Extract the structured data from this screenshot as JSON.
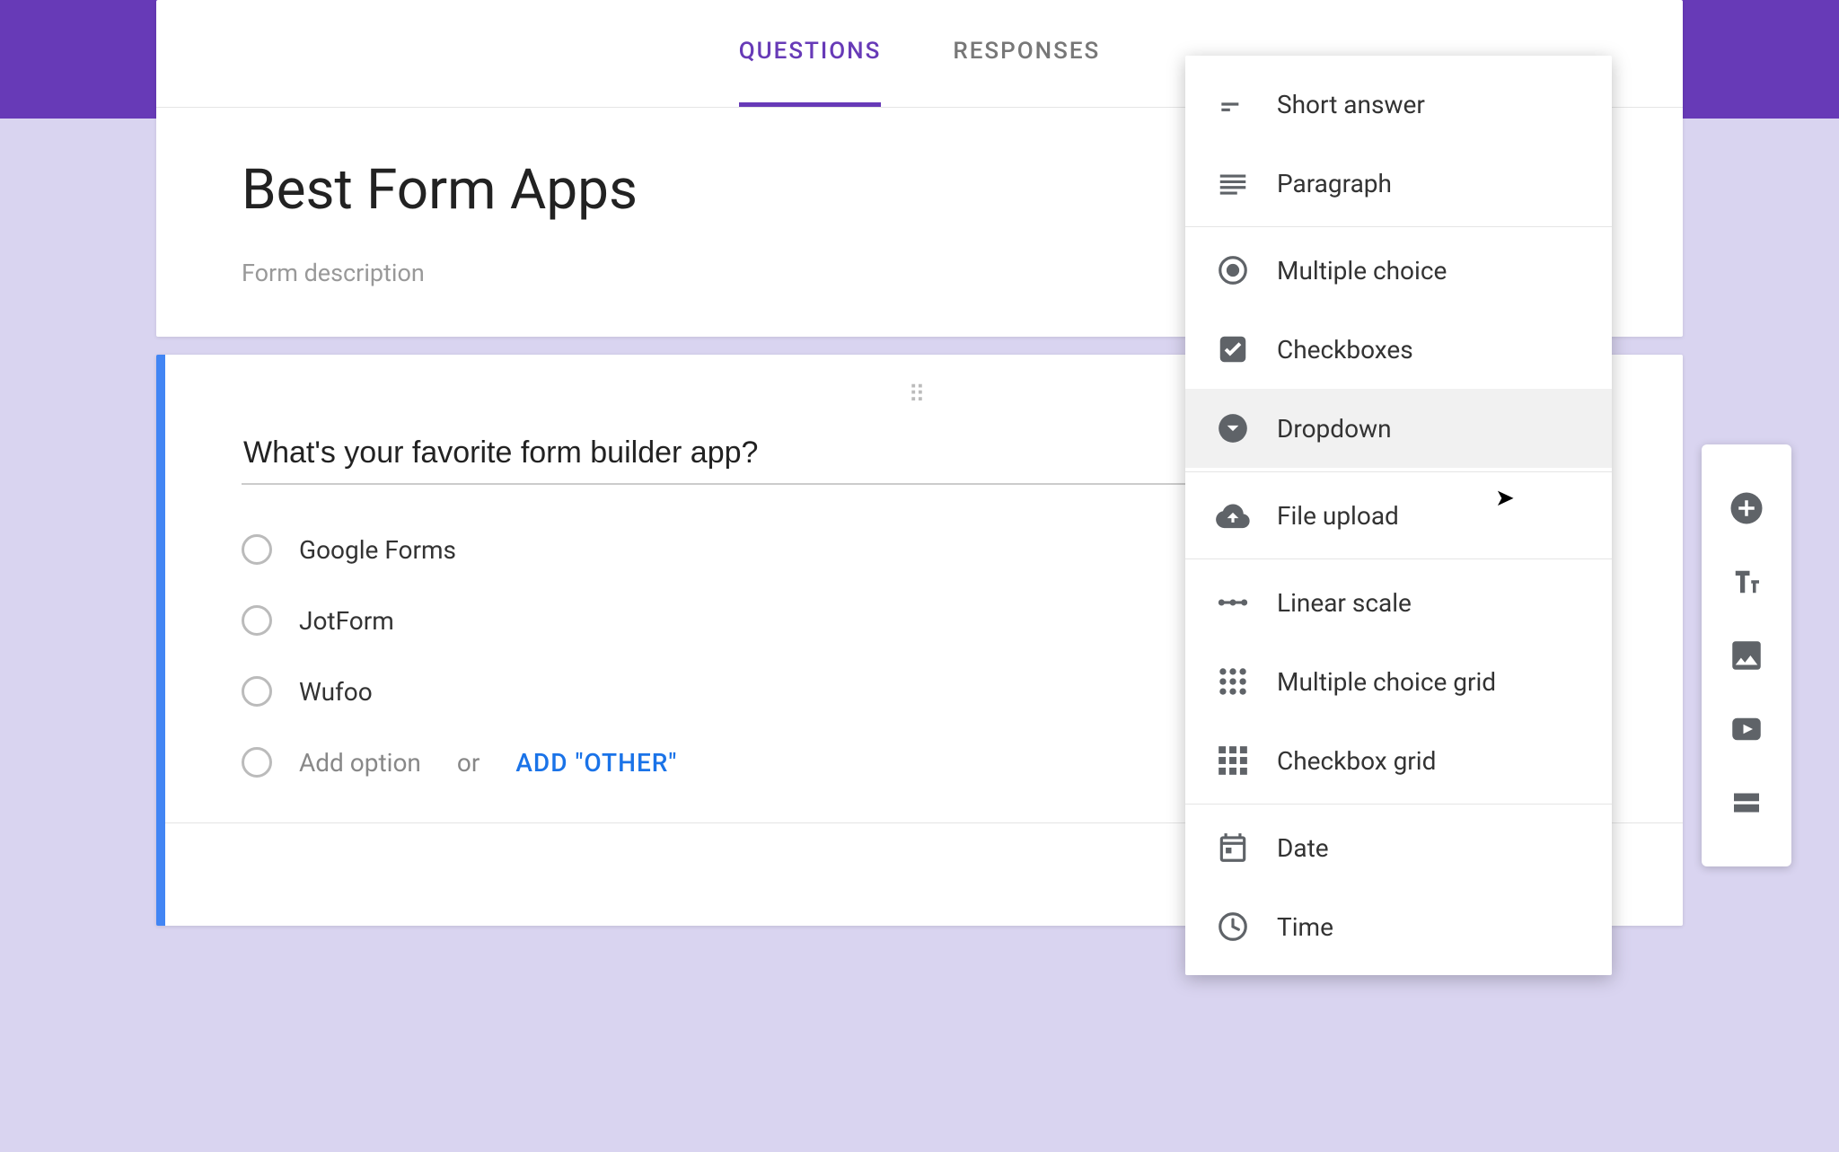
{
  "tabs": {
    "questions": "QUESTIONS",
    "responses": "RESPONSES"
  },
  "form": {
    "title": "Best Form Apps",
    "description_placeholder": "Form description"
  },
  "question": {
    "text": "What's your favorite form builder app?",
    "options": [
      "Google Forms",
      "JotForm",
      "Wufoo"
    ],
    "add_option_label": "Add option",
    "or_label": "or",
    "add_other_label": "ADD \"OTHER\""
  },
  "type_menu": {
    "short_answer": "Short answer",
    "paragraph": "Paragraph",
    "multiple_choice": "Multiple choice",
    "checkboxes": "Checkboxes",
    "dropdown": "Dropdown",
    "file_upload": "File upload",
    "linear_scale": "Linear scale",
    "mc_grid": "Multiple choice grid",
    "cb_grid": "Checkbox grid",
    "date": "Date",
    "time": "Time",
    "hovered": "dropdown"
  },
  "colors": {
    "accent": "#673ab7",
    "card_border": "#4285f4"
  }
}
